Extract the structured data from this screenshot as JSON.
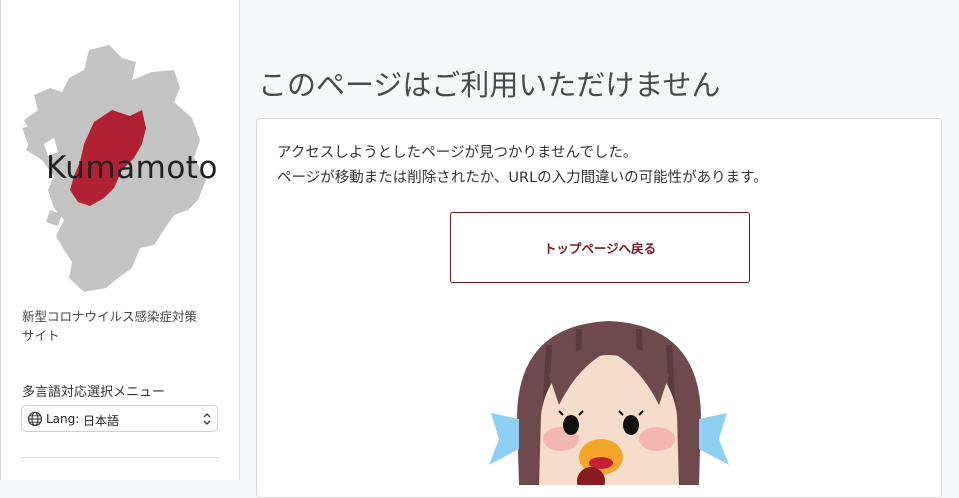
{
  "sidebar": {
    "logo_text": "Kumamoto",
    "site_title": "新型コロナウイルス感染症対策サイト",
    "lang_heading": "多言語対応選択メニュー",
    "lang_label": "Lang:",
    "lang_value": "日本語"
  },
  "main": {
    "title": "このページはご利用いただけません",
    "message_line1": "アクセスしようとしたページが見つかりませんでした。",
    "message_line2": "ページが移動または削除されたか、URLの入力間違いの可能性があります。",
    "back_button": "トップページへ戻る"
  },
  "colors": {
    "accent": "#7a1421",
    "map_gray": "#c4c4c4",
    "map_red": "#b22133"
  },
  "icons": [
    "globe-icon",
    "chevron-updown-icon"
  ]
}
